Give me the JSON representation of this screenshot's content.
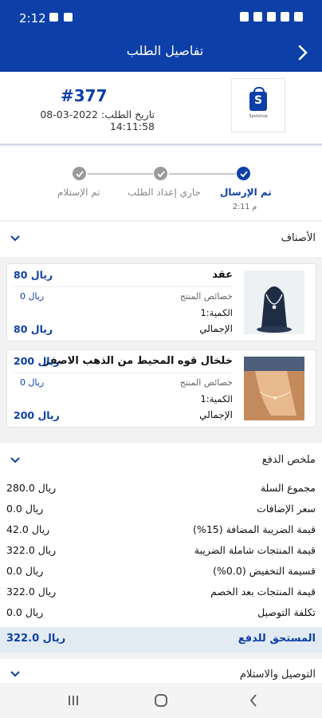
{
  "status": {
    "time": "2:12"
  },
  "appbar": {
    "title": "تفاصيل الطلب"
  },
  "order": {
    "number": "#377",
    "date": "تاريخ الطلب: 2022-03-08 14:11:58",
    "logo_text": "Spotshop"
  },
  "progress": {
    "steps": [
      {
        "label": "تم الإرسال",
        "sub": "2:11 م",
        "done": true
      },
      {
        "label": "جاري إعداد الطلب",
        "done": false
      },
      {
        "label": "تم الإستلام",
        "done": false
      }
    ]
  },
  "items_section": {
    "title": "الأصناف"
  },
  "items": [
    {
      "name": "عقد",
      "price": "80 ريال",
      "attr_label": "خصائص المنتج",
      "attr_value": "0 ريال",
      "qty": "الكمية:1",
      "total_label": "الإجمالي",
      "total_value": "80 ريال",
      "image": "necklace"
    },
    {
      "name": "خلخال قوه المحيط من الذهب الاصفر",
      "price": "200 ريال",
      "attr_label": "خصائص المنتج",
      "attr_value": "0 ريال",
      "qty": "الكمية:1",
      "total_label": "الإجمالي",
      "total_value": "200 ريال",
      "image": "anklet"
    }
  ],
  "summary_section": {
    "title": "ملخص الدفع"
  },
  "summary": [
    {
      "label": "مجموع السلة",
      "value": "280.0 ريال"
    },
    {
      "label": "سعر الإضافات",
      "value": "0.0 ريال"
    },
    {
      "label": "قيمة الضريبة المضافة (15%)",
      "value": "42.0 ريال"
    },
    {
      "label": "قيمة المنتجات شاملة الضريبة",
      "value": "322.0 ريال"
    },
    {
      "label": "قسيمة التخفيض (0.0%)",
      "value": "0.0 ريال"
    },
    {
      "label": "قيمة المنتجات بعد الخصم",
      "value": "322.0 ريال"
    },
    {
      "label": "تكلفة التوصيل",
      "value": "0.0 ريال"
    }
  ],
  "due": {
    "label": "المستحق للدفع",
    "value": "322.0 ريال"
  },
  "delivery_section": {
    "title": "التوصيل والاستلام"
  },
  "colors": {
    "primary": "#0d3fa8",
    "due_bg": "#e2ebf2"
  }
}
